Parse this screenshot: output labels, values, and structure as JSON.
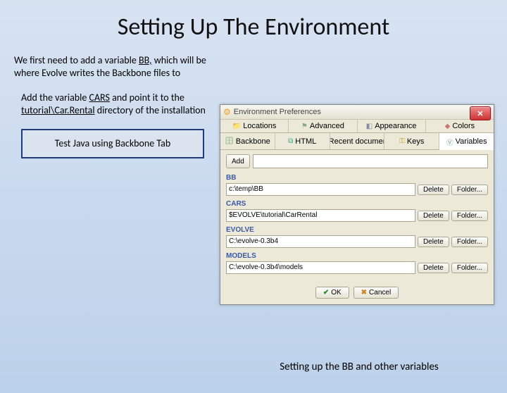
{
  "title": "Setting Up The Environment",
  "para1_a": "We first need to add a variable ",
  "para1_bb": "BB,",
  "para1_b": " which will be where Evolve writes the Backbone files to",
  "para2_a": "Add the variable ",
  "para2_cars": "CARS",
  "para2_b": " and point it to the ",
  "para2_path": "tutorial\\Car.Rental",
  "para2_c": " directory of the installation",
  "callout": "Test Java using Backbone Tab",
  "caption": "Setting up the BB and other variables",
  "dialog": {
    "title": "Environment Preferences",
    "tabs_top": [
      "Locations",
      "Advanced",
      "Appearance",
      "Colors"
    ],
    "tabs_bottom": [
      "Backbone",
      "HTML",
      "Recent documents",
      "Keys",
      "Variables"
    ],
    "selected_tab": "Variables",
    "add_label": "Add",
    "delete_label": "Delete",
    "folder_label": "Folder...",
    "ok_label": "OK",
    "cancel_label": "Cancel",
    "vars": [
      {
        "name": "BB",
        "value": "c:\\temp\\BB"
      },
      {
        "name": "CARS",
        "value": "$EVOLVE\\tutorial\\CarRental"
      },
      {
        "name": "EVOLVE",
        "value": "C:\\evolve-0.3b4"
      },
      {
        "name": "MODELS",
        "value": "C:\\evolve-0.3b4\\models"
      }
    ]
  }
}
